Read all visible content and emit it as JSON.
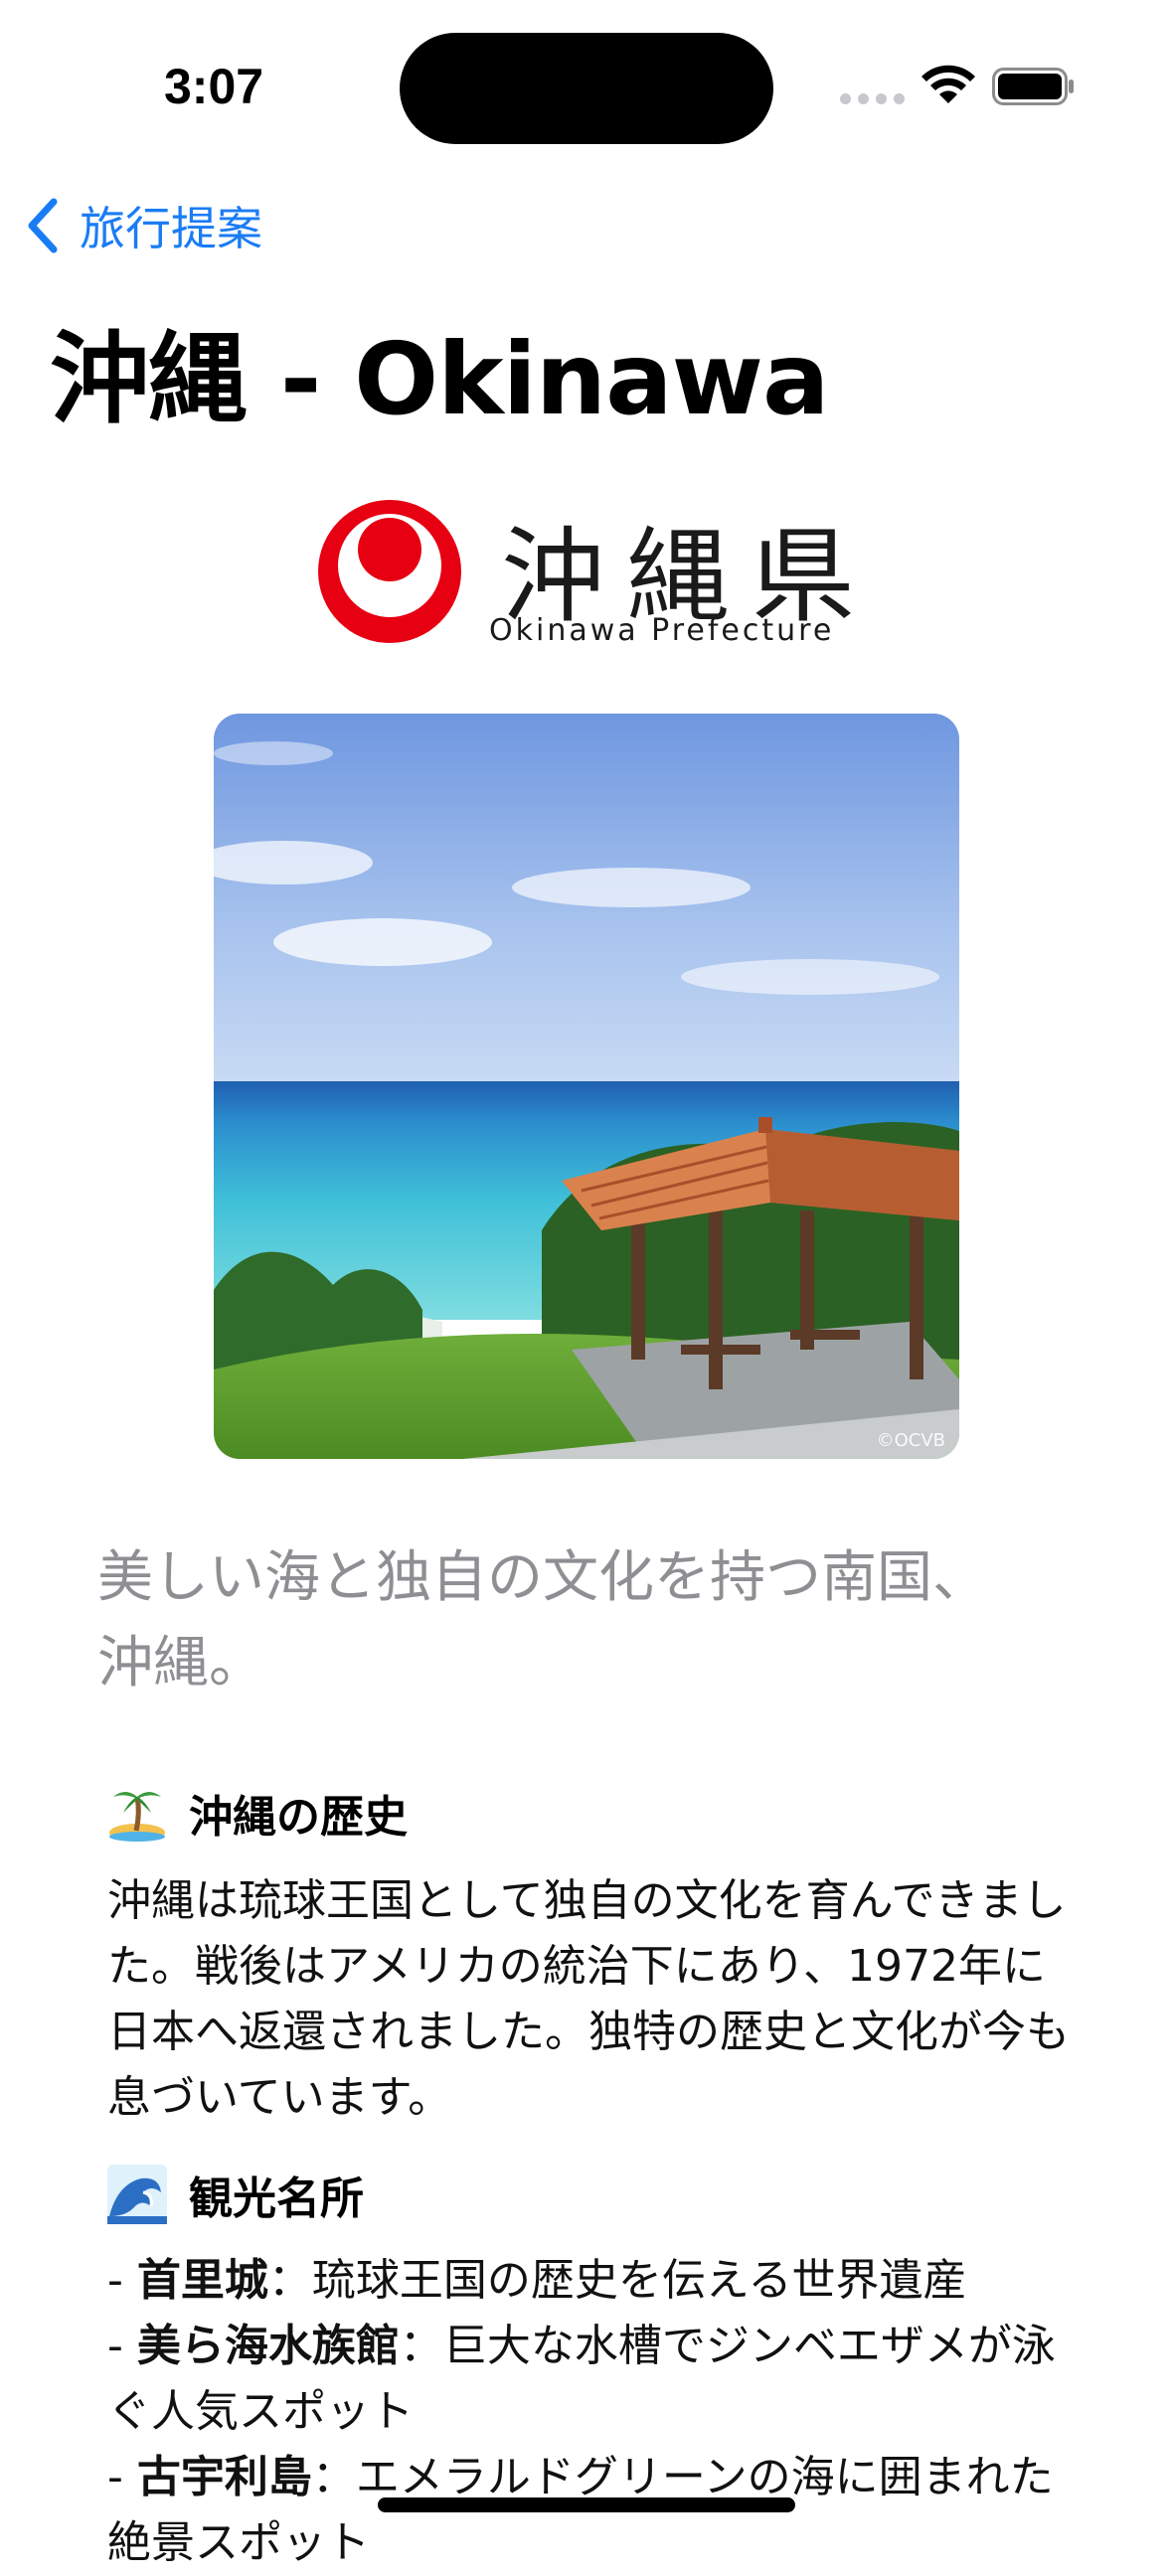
{
  "status_bar": {
    "time": "3:07"
  },
  "nav": {
    "back_label": "旅行提案"
  },
  "page": {
    "title": "沖縄 - Okinawa"
  },
  "logo": {
    "name": "沖縄県",
    "subtitle": "Okinawa Prefecture"
  },
  "photo": {
    "credit": "©OCVB"
  },
  "tagline": "美しい海と独自の文化を持つ南国、沖縄。",
  "history": {
    "icon": "palm-tree-island-icon",
    "heading": "沖縄の歴史",
    "body": "沖縄は琉球王国として独自の文化を育んできました。戦後はアメリカの統治下にあり、1972年に日本へ返還されました。独特の歴史と文化が今も息づいています。"
  },
  "sights": {
    "icon": "wave-icon",
    "heading": "観光名所",
    "items": [
      {
        "prefix": "- ",
        "name": "首里城",
        "desc": "：琉球王国の歴史を伝える世界遺産"
      },
      {
        "prefix": "- ",
        "name": "美ら海水族館",
        "desc": "：巨大な水槽でジンベエザメが泳ぐ人気スポット"
      },
      {
        "prefix": "- ",
        "name": "古宇利島",
        "desc": "：エメラルドグリーンの海に囲まれた絶景スポット"
      }
    ]
  },
  "colors": {
    "accent": "#1a7cf5",
    "logo_red": "#e60012",
    "secondary_text": "#8e8e93"
  }
}
